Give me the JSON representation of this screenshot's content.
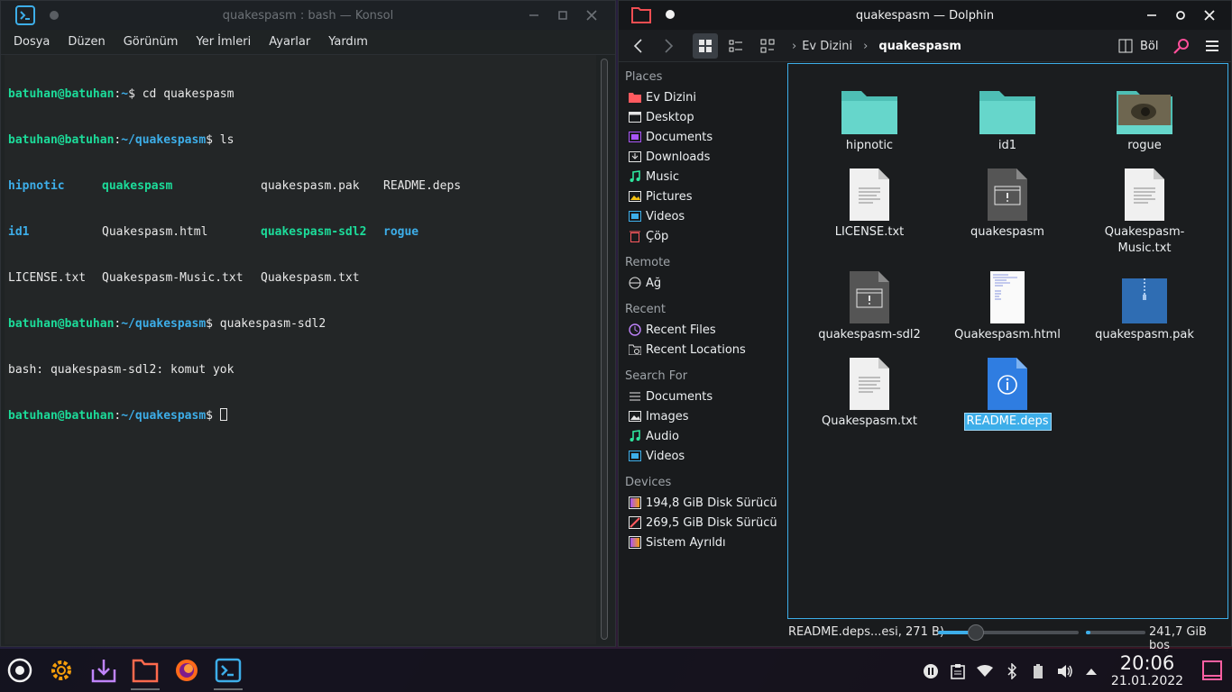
{
  "konsole": {
    "title": "quakespasm : bash — Konsol",
    "menu": [
      "Dosya",
      "Düzen",
      "Görünüm",
      "Yer İmleri",
      "Ayarlar",
      "Yardım"
    ],
    "lines": {
      "l1_user": "batuhan@batuhan",
      "l1_sep": ":",
      "l1_path": "~",
      "l1_cmd": "$ cd quakespasm",
      "l2_user": "batuhan@batuhan",
      "l2_sep": ":",
      "l2_path": "~/quakespasm",
      "l2_cmd": "$ ls",
      "ls": [
        [
          "hipnotic",
          "quakespasm",
          "quakespasm.pak",
          "README.deps"
        ],
        [
          "id1",
          "Quakespasm.html",
          "quakespasm-sdl2",
          "rogue"
        ],
        [
          "LICENSE.txt",
          "Quakespasm-Music.txt",
          "Quakespasm.txt",
          ""
        ]
      ],
      "l6_user": "batuhan@batuhan",
      "l6_sep": ":",
      "l6_path": "~/quakespasm",
      "l6_cmd": "$ quakespasm-sdl2",
      "l7": "bash: quakespasm-sdl2: komut yok",
      "l8_user": "batuhan@batuhan",
      "l8_sep": ":",
      "l8_path": "~/quakespasm",
      "l8_cmd": "$ "
    }
  },
  "dolphin": {
    "title": "quakespasm — Dolphin",
    "breadcrumb": [
      "Ev Dizini",
      "quakespasm"
    ],
    "split_label": "Böl",
    "places": {
      "places_header": "Places",
      "places_items": [
        "Ev Dizini",
        "Desktop",
        "Documents",
        "Downloads",
        "Music",
        "Pictures",
        "Videos",
        "Çöp"
      ],
      "remote_header": "Remote",
      "remote_items": [
        "Ağ"
      ],
      "recent_header": "Recent",
      "recent_items": [
        "Recent Files",
        "Recent Locations"
      ],
      "search_header": "Search For",
      "search_items": [
        "Documents",
        "Images",
        "Audio",
        "Videos"
      ],
      "devices_header": "Devices",
      "devices_items": [
        "194,8 GiB Disk Sürücü",
        "269,5 GiB Disk Sürücü",
        "Sistem Ayrıldı"
      ]
    },
    "files": [
      "hipnotic",
      "id1",
      "rogue",
      "LICENSE.txt",
      "quakespasm",
      "Quakespasm-\nMusic.txt",
      "quakespasm-sdl2",
      "Quakespasm.html",
      "quakespasm.pak",
      "Quakespasm.txt",
      "README.deps"
    ],
    "selected_file": "README.deps",
    "status_text": "README.deps...esi, 271 B)",
    "free_space": "241,7 GiB boş",
    "zoom_level_fraction": 0.27,
    "disk_used_fraction": 0.07
  },
  "taskbar": {
    "time": "20:06",
    "date": "21.01.2022"
  },
  "colors": {
    "accent": "#3daee9",
    "term_green": "#1cdc9a",
    "folder_teal": "#5fd3c8"
  }
}
